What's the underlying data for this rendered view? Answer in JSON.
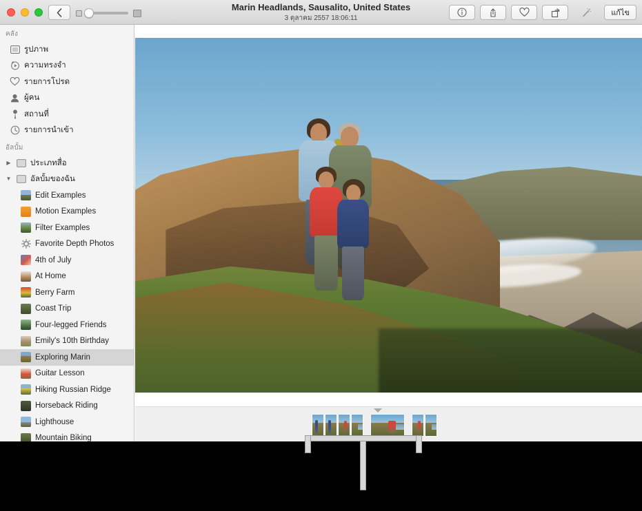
{
  "window": {
    "title": "Marin Headlands, Sausalito, United States",
    "subtitle": "3 ตุลาคม 2557 18:06:11"
  },
  "titlebar": {
    "traffic_lights": [
      "close",
      "minimize",
      "zoom"
    ],
    "back_label": "‹",
    "zoom_slider": {
      "small_icon": "small-thumbnail-icon",
      "large_icon": "large-thumbnail-icon",
      "value": 5
    },
    "buttons": [
      {
        "name": "info-button",
        "icon": "info-icon",
        "label": "ⓘ"
      },
      {
        "name": "share-button",
        "icon": "share-icon",
        "label": "⇧"
      },
      {
        "name": "favorite-button",
        "icon": "heart-icon",
        "label": "♡"
      },
      {
        "name": "rotate-button",
        "icon": "rotate-icon",
        "label": "↻"
      },
      {
        "name": "enhance-button",
        "icon": "magic-wand-icon",
        "label": "✧"
      }
    ],
    "edit_label": "แก้ไข"
  },
  "sidebar": {
    "library_header": "คลัง",
    "library_items": [
      {
        "label": "รูปภาพ",
        "icon": "photos-icon"
      },
      {
        "label": "ความทรงจำ",
        "icon": "memories-icon"
      },
      {
        "label": "รายการโปรด",
        "icon": "heart-icon"
      },
      {
        "label": "ผู้คน",
        "icon": "people-icon"
      },
      {
        "label": "สถานที่",
        "icon": "pin-icon"
      },
      {
        "label": "รายการนำเข้า",
        "icon": "clock-icon"
      }
    ],
    "albums_header": "อัลบั้ม",
    "groups": [
      {
        "label": "ประเภทสื่อ",
        "expanded": false,
        "disclosure": "▶"
      },
      {
        "label": "อัลบั้มของฉัน",
        "expanded": true,
        "disclosure": "▼"
      }
    ],
    "albums": [
      {
        "label": "Edit Examples",
        "selected": false
      },
      {
        "label": "Motion Examples",
        "selected": false
      },
      {
        "label": "Filter Examples",
        "selected": false
      },
      {
        "label": "Favorite Depth Photos",
        "selected": false
      },
      {
        "label": "4th of July",
        "selected": false
      },
      {
        "label": "At Home",
        "selected": false
      },
      {
        "label": "Berry Farm",
        "selected": false
      },
      {
        "label": "Coast Trip",
        "selected": false
      },
      {
        "label": "Four-legged Friends",
        "selected": false
      },
      {
        "label": "Emily's 10th Birthday",
        "selected": false
      },
      {
        "label": "Exploring Marin",
        "selected": true
      },
      {
        "label": "Guitar Lesson",
        "selected": false
      },
      {
        "label": "Hiking Russian Ridge",
        "selected": false
      },
      {
        "label": "Horseback Riding",
        "selected": false
      },
      {
        "label": "Lighthouse",
        "selected": false
      },
      {
        "label": "Mountain Biking",
        "selected": false
      }
    ]
  },
  "main": {
    "photo_alt": "family-portrait-on-coastal-hillside"
  },
  "filmstrip": {
    "caret": "▼",
    "groups": [
      {
        "thumbs": [
          "narrow",
          "narrow",
          "narrow",
          "narrow"
        ]
      },
      {
        "thumbs": [
          "wide"
        ]
      },
      {
        "thumbs": [
          "narrow",
          "narrow"
        ]
      }
    ]
  },
  "colors": {
    "titlebar_top": "#e9e9e9",
    "titlebar_bottom": "#d6d6d6",
    "sidebar_bg": "#f4f4f4",
    "selection": "#d5d5d5",
    "filmstrip_bg": "#efefef",
    "callout": "#d8d8d8",
    "backdrop": "#000000"
  }
}
